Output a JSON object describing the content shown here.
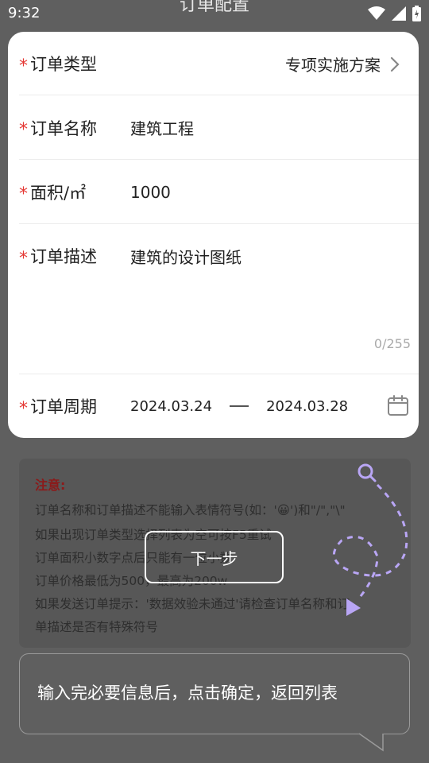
{
  "status": {
    "time": "9:32",
    "title": "订单配置"
  },
  "form": {
    "required_mark": "*",
    "order_type": {
      "label": "订单类型",
      "value": "专项实施方案"
    },
    "order_name": {
      "label": "订单名称",
      "value": "建筑工程"
    },
    "area": {
      "label": "面积/㎡",
      "value": "1000"
    },
    "description": {
      "label": "订单描述",
      "value": "建筑的设计图纸",
      "counter": "0/255"
    },
    "period": {
      "label": "订单周期",
      "start": "2024.03.24",
      "end": "2024.03.28"
    }
  },
  "notice": {
    "title": "注意:",
    "lines": [
      "订单名称和订单描述不能输入表情符号(如：'😀')和\"/\",\"\\\"",
      "如果出现订单类型选择列表为空可按F5重试",
      "订单面积小数字点后只能有一位小数",
      "订单价格最低为500，最高为200w",
      "如果发送订单提示：'数据效验未通过'请检查订单名称和订",
      "单描述是否有特殊符号"
    ]
  },
  "next_button": {
    "label": "下一步"
  },
  "tip": {
    "text": "输入完必要信息后，点击确定，返回列表"
  }
}
